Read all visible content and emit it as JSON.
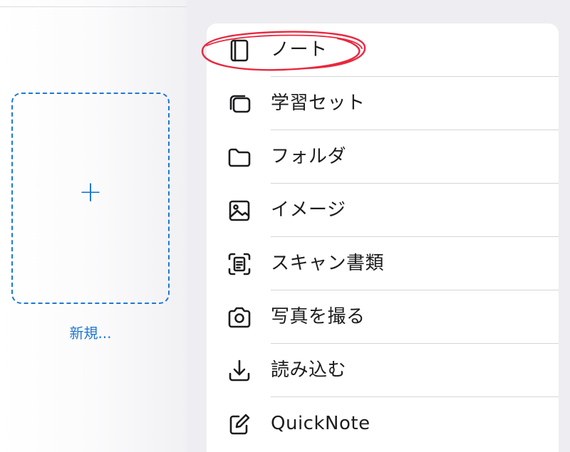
{
  "colors": {
    "accent": "#1f78d0",
    "annotation": "#e8283f",
    "menu_text": "#1c1c1e",
    "separator": "#d5d5da",
    "background": "#ededf2"
  },
  "left_panel": {
    "new_card": {
      "plus_glyph": "+",
      "label": "新規..."
    }
  },
  "menu": {
    "items": [
      {
        "label": "ノート",
        "icon": "notebook-icon"
      },
      {
        "label": "学習セット",
        "icon": "study-set-cards-icon"
      },
      {
        "label": "フォルダ",
        "icon": "folder-icon"
      },
      {
        "label": "イメージ",
        "icon": "image-icon"
      },
      {
        "label": "スキャン書類",
        "icon": "document-scan-icon"
      },
      {
        "label": "写真を撮る",
        "icon": "camera-icon"
      },
      {
        "label": "読み込む",
        "icon": "download-import-icon"
      },
      {
        "label": "QuickNote",
        "icon": "pencil-square-icon"
      }
    ]
  },
  "annotation": {
    "type": "hand-drawn-circle",
    "target": "ノート"
  }
}
